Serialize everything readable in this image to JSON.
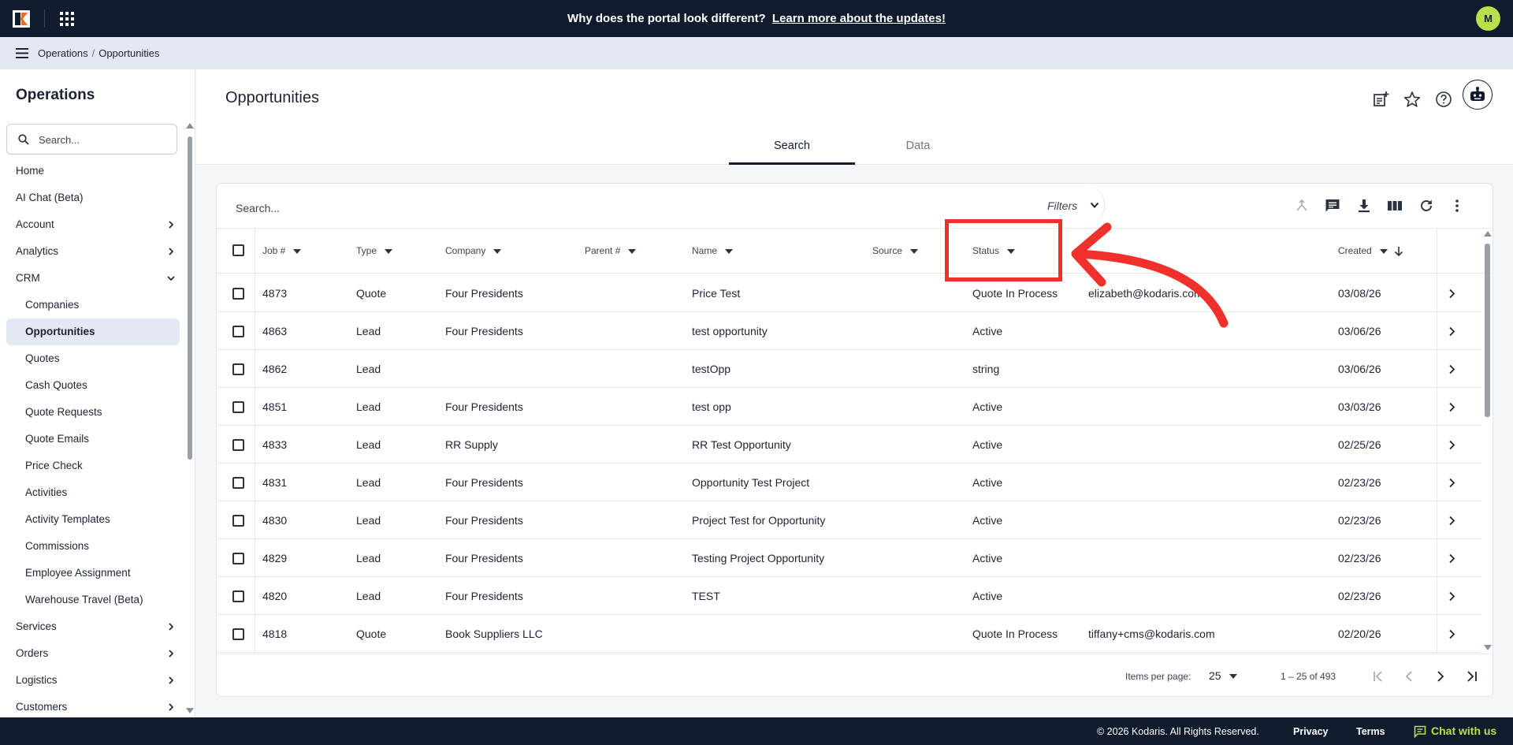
{
  "colors": {
    "topbar": "#111b2e",
    "accent": "#b8e04a",
    "highlight": "#f0312b",
    "active_nav": "#e3e8f4"
  },
  "announcement": {
    "text": "Why does the portal look different?",
    "link": "Learn more about the updates!"
  },
  "user": {
    "initial": "M"
  },
  "breadcrumb": {
    "items": [
      "Operations",
      "Opportunities"
    ],
    "separator": "/"
  },
  "sidebar": {
    "title": "Operations",
    "search_placeholder": "Search...",
    "items": [
      {
        "label": "Home",
        "icon": ""
      },
      {
        "label": "AI Chat (Beta)",
        "icon": ""
      },
      {
        "label": "Account",
        "icon": "chevron-right-icon"
      },
      {
        "label": "Analytics",
        "icon": "chevron-right-icon"
      },
      {
        "label": "CRM",
        "icon": "chevron-down-icon"
      },
      {
        "label": "Companies",
        "sub": true
      },
      {
        "label": "Opportunities",
        "sub": true,
        "active": true
      },
      {
        "label": "Quotes",
        "sub": true
      },
      {
        "label": "Cash Quotes",
        "sub": true
      },
      {
        "label": "Quote Requests",
        "sub": true
      },
      {
        "label": "Quote Emails",
        "sub": true
      },
      {
        "label": "Price Check",
        "sub": true
      },
      {
        "label": "Activities",
        "sub": true
      },
      {
        "label": "Activity Templates",
        "sub": true
      },
      {
        "label": "Commissions",
        "sub": true
      },
      {
        "label": "Employee Assignment",
        "sub": true
      },
      {
        "label": "Warehouse Travel (Beta)",
        "sub": true
      },
      {
        "label": "Services",
        "icon": "chevron-right-icon"
      },
      {
        "label": "Orders",
        "icon": "chevron-right-icon"
      },
      {
        "label": "Logistics",
        "icon": "chevron-right-icon"
      },
      {
        "label": "Customers",
        "icon": "chevron-right-icon"
      }
    ]
  },
  "page": {
    "title": "Opportunities",
    "header_icons": [
      "add-note-icon",
      "star-icon",
      "help-icon",
      "bot-icon"
    ],
    "tabs": [
      {
        "label": "Search",
        "active": true
      },
      {
        "label": "Data",
        "active": false
      }
    ]
  },
  "table": {
    "search_placeholder": "Search...",
    "filters_label": "Filters",
    "toolbar_icons": [
      "merge-icon",
      "comment-icon",
      "download-icon",
      "columns-icon",
      "refresh-icon",
      "more-vert-icon"
    ],
    "columns": [
      "Job #",
      "Type",
      "Company",
      "Parent #",
      "Name",
      "Source",
      "Status",
      "Created"
    ],
    "rows": [
      {
        "job": "4873",
        "type": "Quote",
        "company": "Four Presidents",
        "parent": "",
        "name": "Price Test",
        "source": "",
        "status": "Quote In Process",
        "email": "elizabeth@kodaris.com",
        "created": "03/08/26"
      },
      {
        "job": "4863",
        "type": "Lead",
        "company": "Four Presidents",
        "parent": "",
        "name": "test opportunity",
        "source": "",
        "status": "Active",
        "email": "",
        "created": "03/06/26"
      },
      {
        "job": "4862",
        "type": "Lead",
        "company": "",
        "parent": "",
        "name": "testOpp",
        "source": "",
        "status": "string",
        "email": "",
        "created": "03/06/26"
      },
      {
        "job": "4851",
        "type": "Lead",
        "company": "Four Presidents",
        "parent": "",
        "name": "test opp",
        "source": "",
        "status": "Active",
        "email": "",
        "created": "03/03/26"
      },
      {
        "job": "4833",
        "type": "Lead",
        "company": "RR Supply",
        "parent": "",
        "name": "RR Test Opportunity",
        "source": "",
        "status": "Active",
        "email": "",
        "created": "02/25/26"
      },
      {
        "job": "4831",
        "type": "Lead",
        "company": "Four Presidents",
        "parent": "",
        "name": "Opportunity Test Project",
        "source": "",
        "status": "Active",
        "email": "",
        "created": "02/23/26"
      },
      {
        "job": "4830",
        "type": "Lead",
        "company": "Four Presidents",
        "parent": "",
        "name": "Project Test for Opportunity",
        "source": "",
        "status": "Active",
        "email": "",
        "created": "02/23/26"
      },
      {
        "job": "4829",
        "type": "Lead",
        "company": "Four Presidents",
        "parent": "",
        "name": "Testing Project Opportunity",
        "source": "",
        "status": "Active",
        "email": "",
        "created": "02/23/26"
      },
      {
        "job": "4820",
        "type": "Lead",
        "company": "Four Presidents",
        "parent": "",
        "name": "TEST",
        "source": "",
        "status": "Active",
        "email": "",
        "created": "02/23/26"
      },
      {
        "job": "4818",
        "type": "Quote",
        "company": "Book Suppliers LLC",
        "parent": "",
        "name": "",
        "source": "",
        "status": "Quote In Process",
        "email": "tiffany+cms@kodaris.com",
        "created": "02/20/26"
      }
    ],
    "pagination": {
      "items_per_page_label": "Items per page:",
      "items_per_page": "25",
      "range": "1 – 25 of 493"
    }
  },
  "footer": {
    "copyright": "© 2026 Kodaris. All Rights Reserved.",
    "privacy": "Privacy",
    "terms": "Terms",
    "chat": "Chat with us"
  }
}
